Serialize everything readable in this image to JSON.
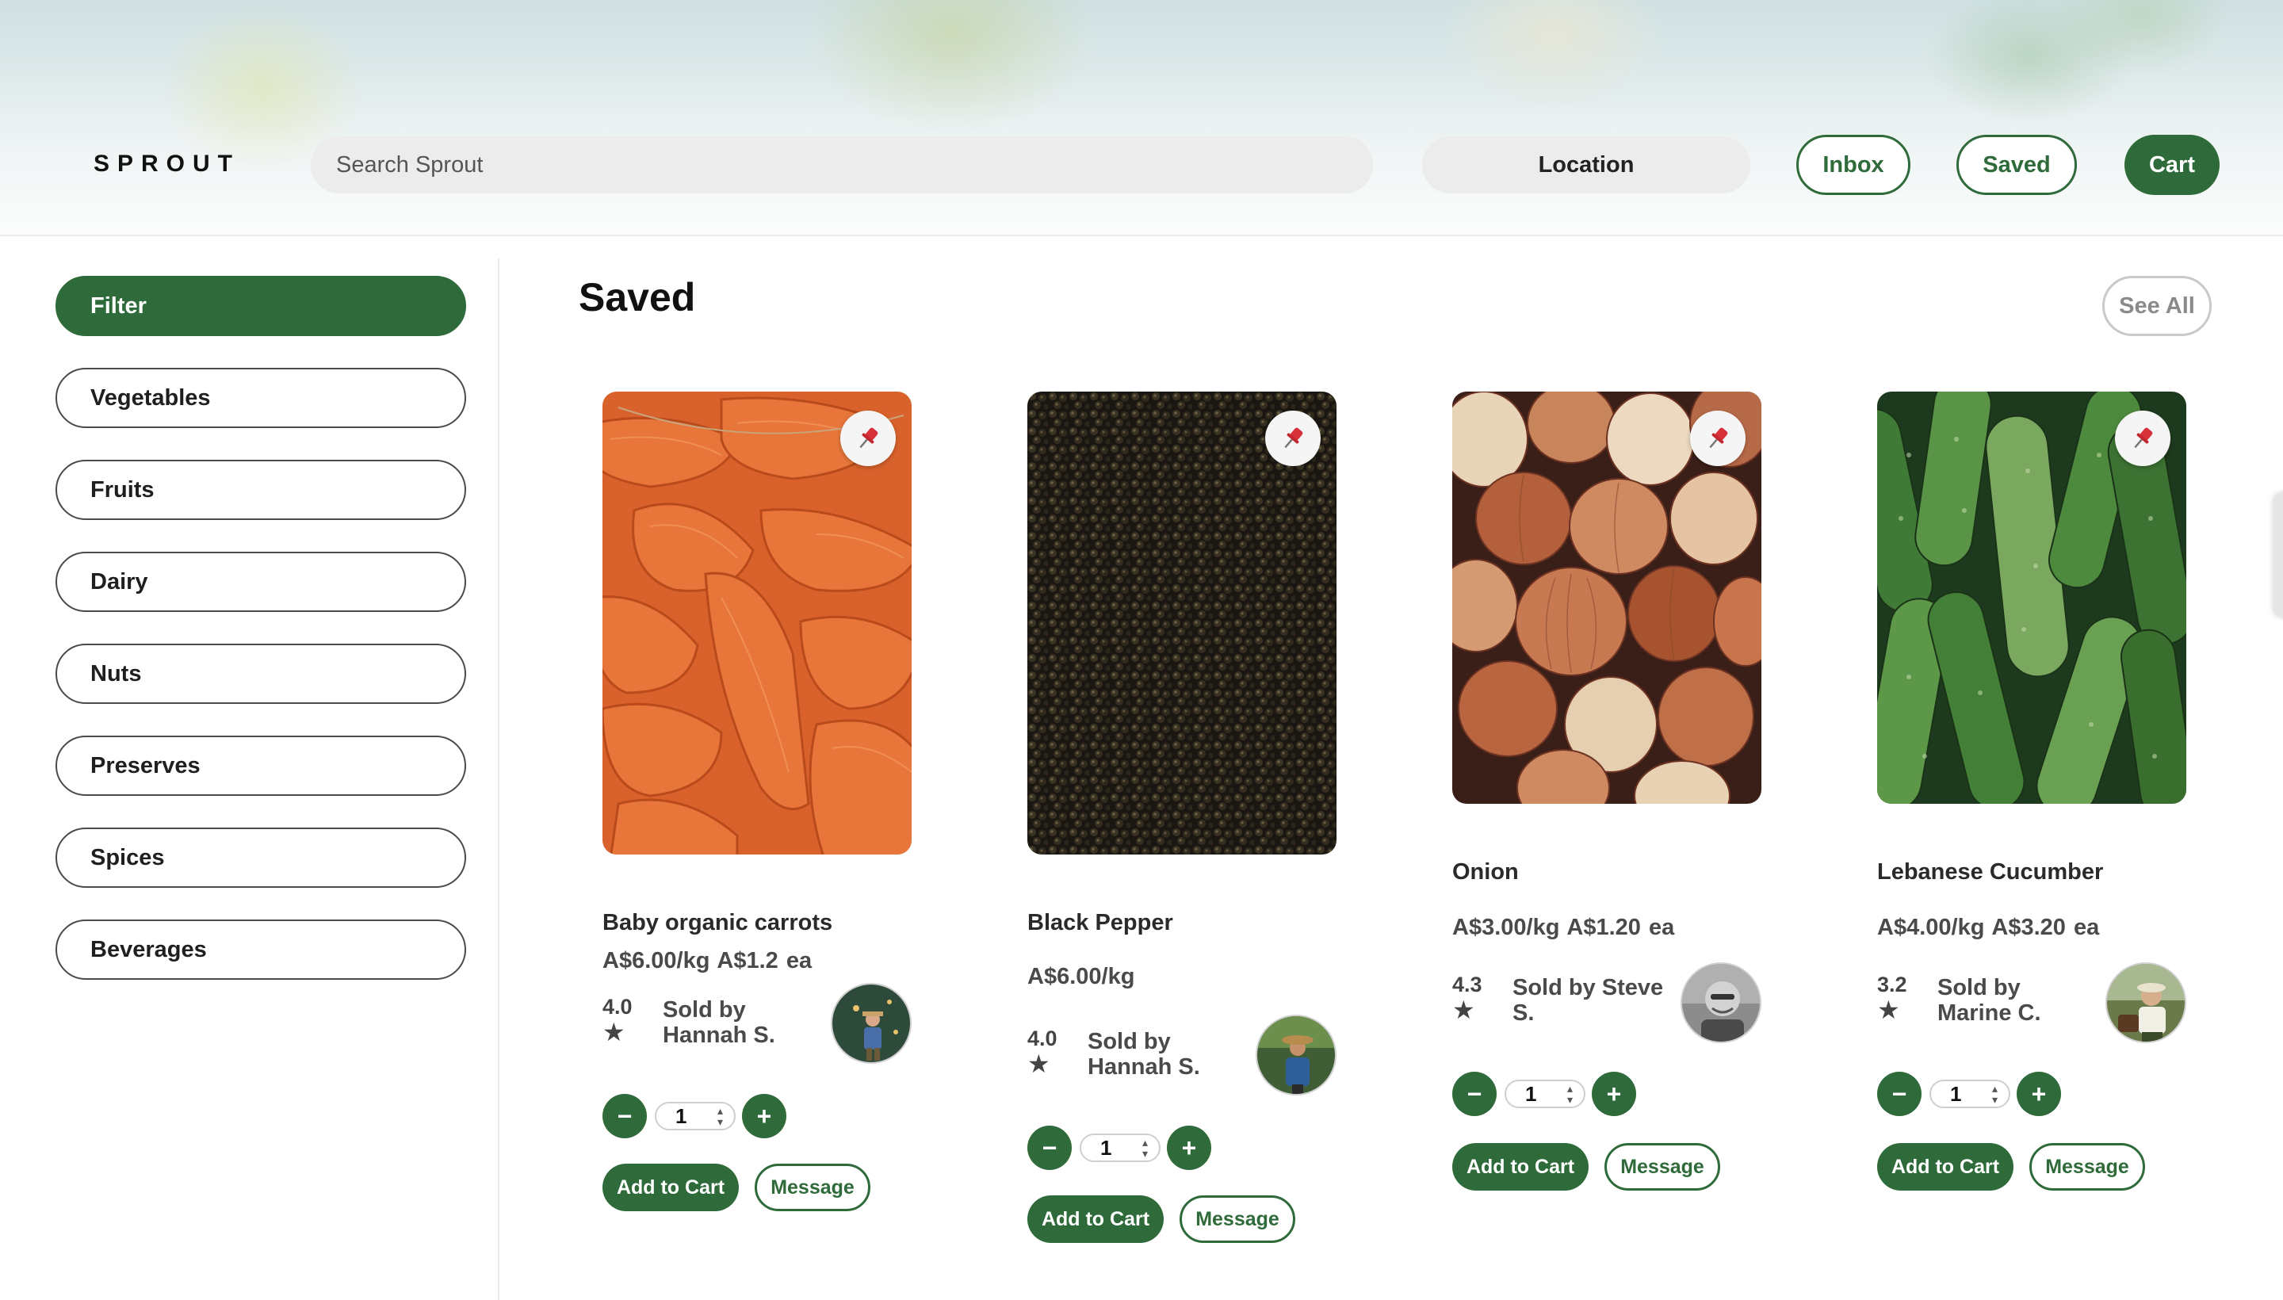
{
  "header": {
    "logo": "SPROUT",
    "search_placeholder": "Search Sprout",
    "location_label": "Location",
    "inbox_label": "Inbox",
    "saved_label": "Saved",
    "cart_label": "Cart"
  },
  "sidebar": {
    "items": [
      {
        "label": "Filter"
      },
      {
        "label": "Vegetables"
      },
      {
        "label": "Fruits"
      },
      {
        "label": "Dairy"
      },
      {
        "label": "Nuts"
      },
      {
        "label": "Preserves"
      },
      {
        "label": "Spices"
      },
      {
        "label": "Beverages"
      }
    ]
  },
  "main": {
    "title": "Saved",
    "see_all_label": "See All",
    "products": [
      {
        "name": "Baby organic carrots",
        "price": "A$6.00/kg   A$1.2 ea",
        "rating": "4.0",
        "star": "★",
        "seller_line1": "Sold by",
        "seller_line2": "Hannah S.",
        "qty": "1",
        "minus": "−",
        "plus": "+",
        "add_to_cart": "Add to Cart",
        "message": "Message",
        "icon": "pin-icon"
      },
      {
        "name": "Black Pepper",
        "price": "A$6.00/kg",
        "rating": "4.0",
        "star": "★",
        "seller_line1": "Sold by",
        "seller_line2": "Hannah S.",
        "qty": "1",
        "minus": "−",
        "plus": "+",
        "add_to_cart": "Add to Cart",
        "message": "Message",
        "icon": "pin-icon"
      },
      {
        "name": "Onion",
        "price": "A$3.00/kg   A$1.20 ea",
        "rating": "4.3",
        "star": "★",
        "seller_line1": "Sold by Steve",
        "seller_line2": "S.",
        "qty": "1",
        "minus": "−",
        "plus": "+",
        "add_to_cart": "Add to Cart",
        "message": "Message",
        "icon": "pin-icon"
      },
      {
        "name": "Lebanese Cucumber",
        "price": "A$4.00/kg   A$3.20 ea",
        "rating": "3.2",
        "star": "★",
        "seller_line1": "Sold by",
        "seller_line2": "Marine C.",
        "qty": "1",
        "minus": "−",
        "plus": "+",
        "add_to_cart": "Add to Cart",
        "message": "Message",
        "icon": "pin-icon"
      }
    ]
  },
  "colors": {
    "accent": "#2f6b3a",
    "chip_background": "#ececec",
    "text": "#1b1b1b"
  }
}
